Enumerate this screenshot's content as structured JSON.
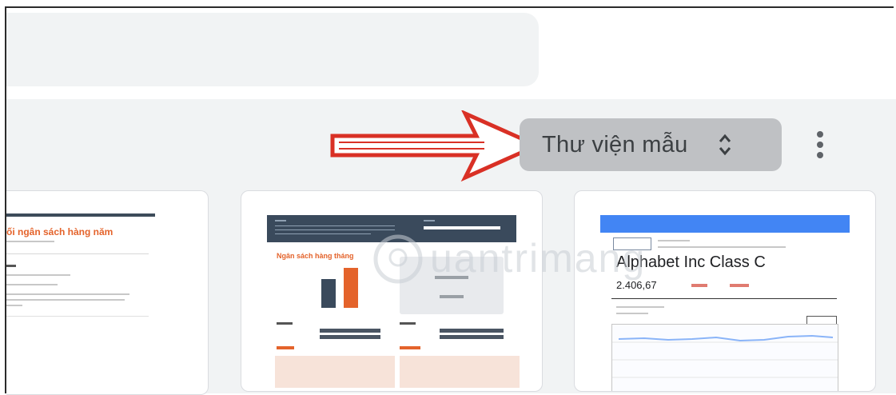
{
  "toolbar": {
    "gallery_label": "Thư viện mẫu",
    "more_icon": "kebab-menu-icon",
    "toggle_icon": "unfold-chevron-icon"
  },
  "templates": [
    {
      "title": "ối ngân sách hàng năm"
    },
    {
      "title": "Ngân sách hàng tháng"
    },
    {
      "title": "Alphabet Inc Class C",
      "price": "2.406,67"
    }
  ],
  "watermark": "uantrimang",
  "colors": {
    "accent_orange": "#e4632b",
    "navy": "#3a4a5c",
    "blue": "#4285f4",
    "arrow_red": "#d93025",
    "button_bg": "#bfc1c4",
    "gallery_bg": "#f1f3f4"
  }
}
